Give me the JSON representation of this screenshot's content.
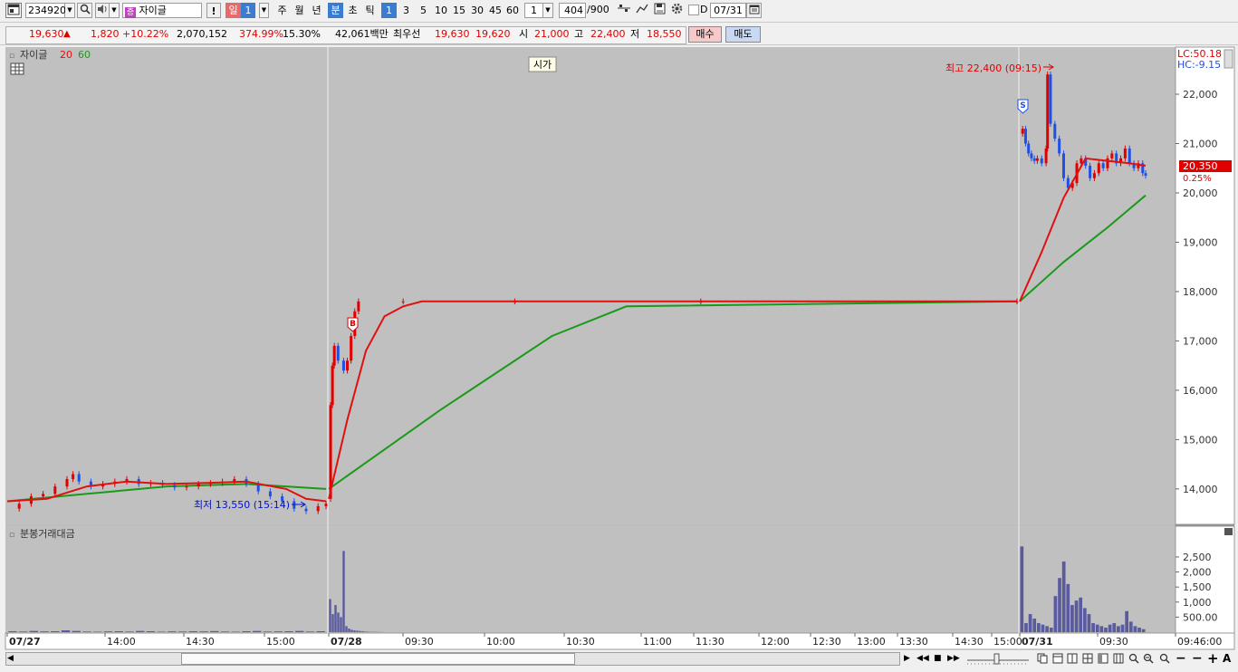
{
  "toolbar": {
    "code": "234920",
    "stock_badge": "증",
    "stock_name": "자이글",
    "excl": "!",
    "period_day": "일",
    "period_day_num": "1",
    "period_week": "주",
    "period_month": "월",
    "period_year": "년",
    "period_min": "분",
    "period_sec": "초",
    "period_tick": "틱",
    "intervals": [
      "1",
      "3",
      "5",
      "10",
      "15",
      "30",
      "45",
      "60"
    ],
    "interval_custom": "1",
    "count_current": "404",
    "count_total": "/900",
    "d_label": "D",
    "date": "07/31"
  },
  "quote": {
    "price": "19,630",
    "arrow": "▲",
    "change": "1,820",
    "change_pct": "+10.22%",
    "volume": "2,070,152",
    "vol_ratio": "374.99%",
    "turnover": "15.30%",
    "amount": "42,061백만",
    "best_label": "최우선",
    "best_ask": "19,630",
    "best_bid": "19,620",
    "open_label": "시",
    "open": "21,000",
    "high_label": "고",
    "high": "22,400",
    "low_label": "저",
    "low": "18,550",
    "buy_btn": "매수",
    "sell_btn": "매도"
  },
  "colors": {
    "chart_bg": "#c0c0c0",
    "up": "#e00000",
    "down": "#1e50e6",
    "ma20": "#e01010",
    "ma60": "#1a9a1a",
    "volume_bar": "#5a5a9e"
  },
  "price_panel": {
    "name": "자이글",
    "ma_short": "20",
    "ma_long": "60",
    "open_tag": "시가",
    "high_note": "최고 22,400 (09:15)",
    "low_note": "최저 13,550 (15:14)",
    "lc": "LC:50.18",
    "hc": "HC:-9.15",
    "current_price": "20,350",
    "current_pct": "0.25%",
    "buy_marker": "B",
    "sell_marker": "S"
  },
  "volume_panel": {
    "name": "분봉거래대금"
  },
  "chart_data": [
    {
      "type": "candlestick",
      "name": "price",
      "y_ticks": [
        "22,000",
        "21,000",
        "20,000",
        "19,000",
        "18,000",
        "17,000",
        "16,000",
        "15,000",
        "14,000"
      ],
      "ylim": [
        13300,
        22900
      ],
      "segments": [
        {
          "day": "07/27",
          "points": [
            [
              0,
              13600
            ],
            [
              6,
              13700
            ],
            [
              12,
              13850
            ],
            [
              18,
              13900
            ],
            [
              24,
              14050
            ],
            [
              30,
              14200
            ],
            [
              33,
              14300
            ],
            [
              36,
              14150
            ],
            [
              42,
              14050
            ],
            [
              48,
              14100
            ],
            [
              54,
              14150
            ],
            [
              60,
              14200
            ],
            [
              66,
              14100
            ],
            [
              72,
              14120
            ],
            [
              78,
              14080
            ],
            [
              84,
              14030
            ],
            [
              90,
              14050
            ],
            [
              96,
              14100
            ],
            [
              102,
              14120
            ],
            [
              108,
              14150
            ],
            [
              114,
              14200
            ],
            [
              120,
              14100
            ],
            [
              126,
              13950
            ],
            [
              132,
              13850
            ],
            [
              138,
              13750
            ],
            [
              144,
              13600
            ],
            [
              150,
              13550
            ],
            [
              156,
              13650
            ],
            [
              160,
              13700
            ]
          ]
        },
        {
          "day": "07/28",
          "points": [
            [
              0,
              13800
            ],
            [
              1,
              15700
            ],
            [
              2,
              16500
            ],
            [
              3,
              16900
            ],
            [
              5,
              16600
            ],
            [
              8,
              16400
            ],
            [
              10,
              16600
            ],
            [
              12,
              17100
            ],
            [
              14,
              17600
            ],
            [
              16,
              17800
            ],
            [
              40,
              17800
            ],
            [
              100,
              17800
            ],
            [
              200,
              17800
            ],
            [
              370,
              17800
            ]
          ]
        },
        {
          "day": "07/31",
          "points": [
            [
              0,
              21200
            ],
            [
              2,
              21300
            ],
            [
              4,
              21000
            ],
            [
              6,
              20800
            ],
            [
              8,
              20700
            ],
            [
              10,
              20650
            ],
            [
              12,
              20700
            ],
            [
              15,
              20600
            ],
            [
              18,
              20900
            ],
            [
              19,
              22400
            ],
            [
              21,
              21400
            ],
            [
              24,
              21100
            ],
            [
              27,
              20800
            ],
            [
              30,
              20300
            ],
            [
              33,
              20100
            ],
            [
              36,
              20200
            ],
            [
              39,
              20600
            ],
            [
              42,
              20700
            ],
            [
              45,
              20550
            ],
            [
              48,
              20300
            ],
            [
              51,
              20400
            ],
            [
              54,
              20600
            ],
            [
              57,
              20500
            ],
            [
              60,
              20700
            ],
            [
              63,
              20800
            ],
            [
              66,
              20600
            ],
            [
              69,
              20700
            ],
            [
              72,
              20900
            ],
            [
              75,
              20600
            ],
            [
              78,
              20500
            ],
            [
              81,
              20600
            ],
            [
              84,
              20400
            ],
            [
              86,
              20350
            ]
          ]
        }
      ],
      "ma20_segments": [
        {
          "day": "07/27",
          "points": [
            [
              0,
              13750
            ],
            [
              20,
              13800
            ],
            [
              40,
              14050
            ],
            [
              60,
              14150
            ],
            [
              80,
              14100
            ],
            [
              100,
              14120
            ],
            [
              120,
              14150
            ],
            [
              140,
              14000
            ],
            [
              150,
              13800
            ],
            [
              160,
              13750
            ]
          ]
        },
        {
          "day": "07/28",
          "points": [
            [
              0,
              13800
            ],
            [
              10,
              15400
            ],
            [
              20,
              16800
            ],
            [
              30,
              17500
            ],
            [
              40,
              17700
            ],
            [
              50,
              17800
            ],
            [
              370,
              17800
            ]
          ]
        },
        {
          "day": "07/31",
          "points": [
            [
              0,
              17800
            ],
            [
              15,
              18800
            ],
            [
              30,
              19900
            ],
            [
              45,
              20700
            ],
            [
              60,
              20650
            ],
            [
              75,
              20600
            ],
            [
              86,
              20550
            ]
          ]
        }
      ],
      "ma60_segments": [
        {
          "day": "07/27",
          "points": [
            [
              0,
              13750
            ],
            [
              40,
              13900
            ],
            [
              80,
              14050
            ],
            [
              120,
              14100
            ],
            [
              160,
              14000
            ]
          ]
        },
        {
          "day": "07/28",
          "points": [
            [
              0,
              14000
            ],
            [
              60,
              15600
            ],
            [
              120,
              17100
            ],
            [
              160,
              17700
            ],
            [
              370,
              17800
            ]
          ]
        },
        {
          "day": "07/31",
          "points": [
            [
              0,
              17800
            ],
            [
              30,
              18600
            ],
            [
              60,
              19300
            ],
            [
              86,
              19950
            ]
          ]
        }
      ]
    },
    {
      "type": "bar",
      "name": "분봉거래대금",
      "y_ticks": [
        "2,500",
        "2,000",
        "1,500",
        "1,000",
        "500.00"
      ],
      "ylim": [
        0,
        2800
      ],
      "segments": [
        {
          "day": "07/27",
          "values": [
            30,
            20,
            40,
            25,
            30,
            60,
            40,
            20,
            15,
            25,
            30,
            20,
            40,
            30,
            15,
            25,
            20,
            30,
            25,
            35,
            20,
            15,
            30,
            40,
            20,
            25,
            30,
            40,
            20,
            30
          ]
        },
        {
          "day": "07/28",
          "values": [
            1100,
            600,
            900,
            650,
            500,
            2700,
            200,
            120,
            80,
            60,
            50,
            40,
            30,
            20,
            15,
            10,
            10,
            10,
            5,
            5
          ]
        },
        {
          "day": "07/31",
          "values": [
            2850,
            300,
            600,
            450,
            300,
            250,
            200,
            150,
            1200,
            1800,
            2350,
            1600,
            900,
            1050,
            1150,
            800,
            600,
            300,
            250,
            200,
            150,
            250,
            300,
            200,
            250,
            700,
            350,
            200,
            150,
            100
          ]
        }
      ],
      "x_ticks": [
        "07/27",
        "14:00",
        "14:30",
        "15:00",
        "07/28",
        "09:30",
        "10:00",
        "10:30",
        "11:00",
        "11:30",
        "12:00",
        "12:30",
        "13:00",
        "13:30",
        "14:30",
        "15:00",
        "07/31",
        "09:30",
        "09:46:00"
      ]
    }
  ]
}
